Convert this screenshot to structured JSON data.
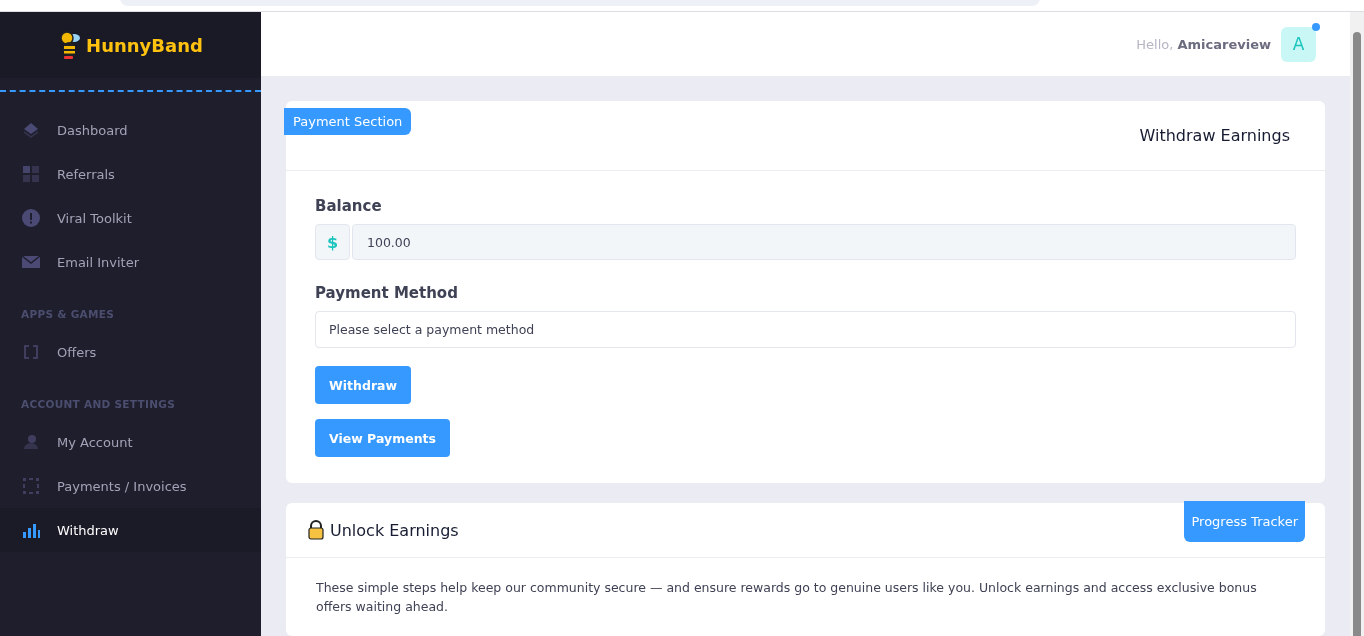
{
  "sidebar": {
    "logo": "HunnyBand",
    "sections": [
      {
        "items": [
          {
            "label": "Dashboard",
            "kind": "layers",
            "selected": false
          },
          {
            "label": "Referrals",
            "kind": "grid",
            "selected": false
          },
          {
            "label": "Viral Toolkit",
            "kind": "alert",
            "selected": false
          },
          {
            "label": "Email Inviter",
            "kind": "mail",
            "selected": false
          }
        ]
      },
      {
        "heading": "APPS & GAMES",
        "items": [
          {
            "label": "Offers",
            "kind": "frame",
            "selected": false
          }
        ]
      },
      {
        "heading": "ACCOUNT AND SETTINGS",
        "items": [
          {
            "label": "My Account",
            "kind": "user",
            "selected": false
          },
          {
            "label": "Payments / Invoices",
            "kind": "dots",
            "selected": false
          },
          {
            "label": "Withdraw",
            "kind": "bars",
            "selected": true
          }
        ]
      }
    ]
  },
  "header": {
    "greeting": "Hello,",
    "username": "Amicareview",
    "avatar": "A",
    "notification": true
  },
  "payment_card": {
    "tag": "Payment Section",
    "title": "Withdraw Earnings",
    "balance_label": "Balance",
    "currency": "$",
    "balance": "100.00",
    "method_label": "Payment Method",
    "method_placeholder": "Please select a payment method",
    "buttons": [
      "Withdraw",
      "View Payments"
    ]
  },
  "unlock_card": {
    "title": "Unlock Earnings",
    "tag": "Progress Tracker",
    "text": "These simple steps help keep our community secure — and ensure rewards go to genuine users like you. Unlock earnings and access exclusive bonus offers waiting ahead."
  }
}
